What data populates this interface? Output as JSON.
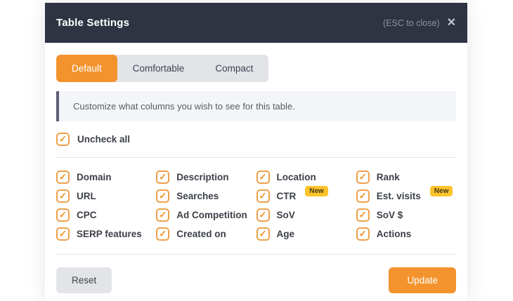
{
  "modal": {
    "title": "Table Settings",
    "esc_hint": "(ESC to close)",
    "close_icon": "✕"
  },
  "tabs": [
    {
      "label": "Default",
      "active": true
    },
    {
      "label": "Comfortable",
      "active": false
    },
    {
      "label": "Compact",
      "active": false
    }
  ],
  "info": {
    "text": "Customize what columns you wish to see for this table."
  },
  "uncheck_all": {
    "label": "Uncheck all",
    "checked": true,
    "check_glyph": "✓"
  },
  "columns_grid": {
    "items": [
      {
        "label": "Domain",
        "checked": true,
        "badge": ""
      },
      {
        "label": "Description",
        "checked": true,
        "badge": ""
      },
      {
        "label": "Location",
        "checked": true,
        "badge": ""
      },
      {
        "label": "Rank",
        "checked": true,
        "badge": ""
      },
      {
        "label": "URL",
        "checked": true,
        "badge": ""
      },
      {
        "label": "Searches",
        "checked": true,
        "badge": ""
      },
      {
        "label": "CTR",
        "checked": true,
        "badge": "New"
      },
      {
        "label": "Est. visits",
        "checked": true,
        "badge": "New"
      },
      {
        "label": "CPC",
        "checked": true,
        "badge": ""
      },
      {
        "label": "Ad Competition",
        "checked": true,
        "badge": ""
      },
      {
        "label": "SoV",
        "checked": true,
        "badge": ""
      },
      {
        "label": "SoV $",
        "checked": true,
        "badge": ""
      },
      {
        "label": "SERP features",
        "checked": true,
        "badge": ""
      },
      {
        "label": "Created on",
        "checked": true,
        "badge": ""
      },
      {
        "label": "Age",
        "checked": true,
        "badge": ""
      },
      {
        "label": "Actions",
        "checked": true,
        "badge": ""
      }
    ]
  },
  "footer": {
    "reset_label": "Reset",
    "update_label": "Update"
  },
  "colors": {
    "header_bg": "#2e3442",
    "accent_orange": "#f3932e",
    "badge_yellow": "#fcc32c",
    "checkbox_border": "#eda04a"
  }
}
